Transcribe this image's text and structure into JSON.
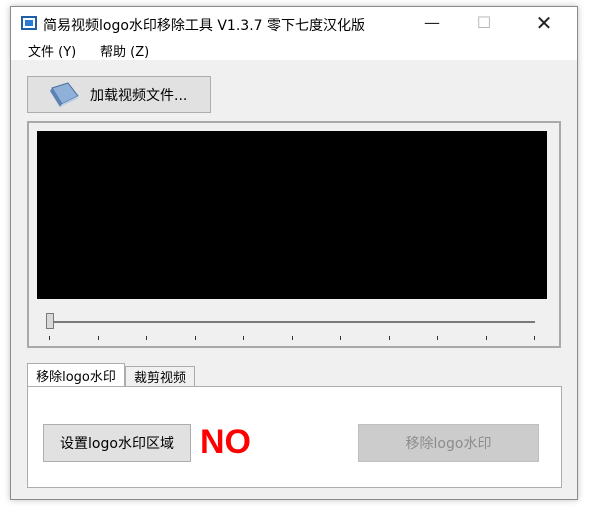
{
  "window": {
    "title": "简易视频logo水印移除工具 V1.3.7 零下七度汉化版",
    "controls": {
      "minimize": "—",
      "maximize": "☐",
      "close": "✕"
    }
  },
  "menu": {
    "items": [
      {
        "label": "文件 (Y)"
      },
      {
        "label": "帮助 (Z)"
      }
    ]
  },
  "toolbar": {
    "load_button_label": "加载视频文件...",
    "load_button_icon": "file-open-icon"
  },
  "player": {
    "slider_progress": 0
  },
  "tabs": [
    {
      "label": "移除logo水印",
      "active": true
    },
    {
      "label": "裁剪视频",
      "active": false
    }
  ],
  "logo_panel": {
    "set_region_label": "设置logo水印区域",
    "status_text": "NO",
    "status_color": "#ff0000",
    "remove_label": "移除logo水印",
    "remove_enabled": false
  }
}
